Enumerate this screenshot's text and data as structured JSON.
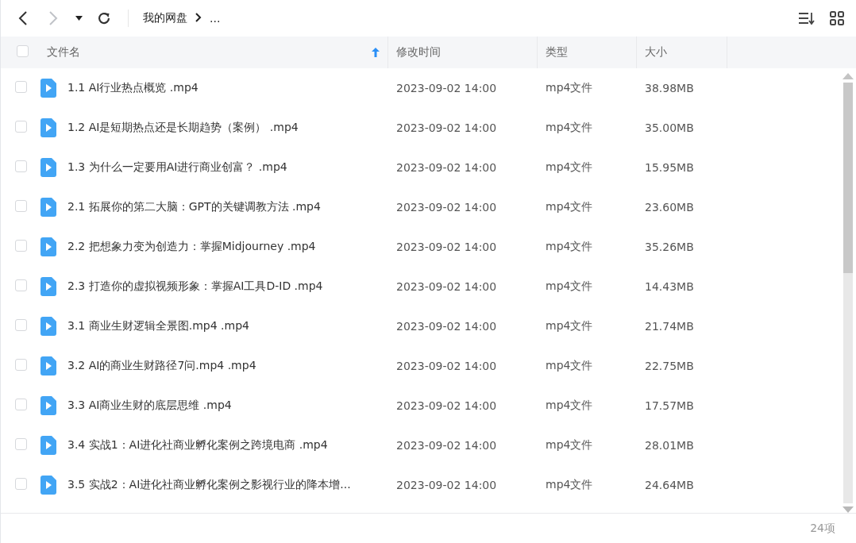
{
  "toolbar": {
    "back_enabled": true,
    "forward_enabled": false,
    "breadcrumb": [
      "我的网盘",
      "..."
    ]
  },
  "table": {
    "select_all_checked": false,
    "columns": [
      {
        "label": "文件名",
        "sorted": true
      },
      {
        "label": "修改时间",
        "sorted": false
      },
      {
        "label": "类型",
        "sorted": false
      },
      {
        "label": "大小",
        "sorted": false
      }
    ],
    "rows": [
      {
        "name": "1.1 AI行业热点概览 .mp4",
        "modified": "2023-09-02 14:00",
        "type": "mp4文件",
        "size": "38.98MB",
        "checked": false
      },
      {
        "name": "1.2 AI是短期热点还是长期趋势（案例） .mp4",
        "modified": "2023-09-02 14:00",
        "type": "mp4文件",
        "size": "35.00MB",
        "checked": false
      },
      {
        "name": "1.3 为什么一定要用AI进行商业创富？ .mp4",
        "modified": "2023-09-02 14:00",
        "type": "mp4文件",
        "size": "15.95MB",
        "checked": false
      },
      {
        "name": "2.1 拓展你的第二大脑：GPT的关键调教方法 .mp4",
        "modified": "2023-09-02 14:00",
        "type": "mp4文件",
        "size": "23.60MB",
        "checked": false
      },
      {
        "name": "2.2 把想象力变为创造力：掌握Midjourney .mp4",
        "modified": "2023-09-02 14:00",
        "type": "mp4文件",
        "size": "35.26MB",
        "checked": false
      },
      {
        "name": "2.3 打造你的虚拟视频形象：掌握AI工具D-ID .mp4",
        "modified": "2023-09-02 14:00",
        "type": "mp4文件",
        "size": "14.43MB",
        "checked": false
      },
      {
        "name": "3.1 商业生财逻辑全景图.mp4 .mp4",
        "modified": "2023-09-02 14:00",
        "type": "mp4文件",
        "size": "21.74MB",
        "checked": false
      },
      {
        "name": "3.2 AI的商业生财路径7问.mp4 .mp4",
        "modified": "2023-09-02 14:00",
        "type": "mp4文件",
        "size": "22.75MB",
        "checked": false
      },
      {
        "name": "3.3 AI商业生财的底层思维 .mp4",
        "modified": "2023-09-02 14:00",
        "type": "mp4文件",
        "size": "17.57MB",
        "checked": false
      },
      {
        "name": "3.4 实战1：AI进化社商业孵化案例之跨境电商 .mp4",
        "modified": "2023-09-02 14:00",
        "type": "mp4文件",
        "size": "28.01MB",
        "checked": false
      },
      {
        "name": "3.5 实战2：AI进化社商业孵化案例之影视行业的降本增...",
        "modified": "2023-09-02 14:00",
        "type": "mp4文件",
        "size": "24.64MB",
        "checked": false
      }
    ]
  },
  "status_bar": {
    "count": "24项"
  }
}
